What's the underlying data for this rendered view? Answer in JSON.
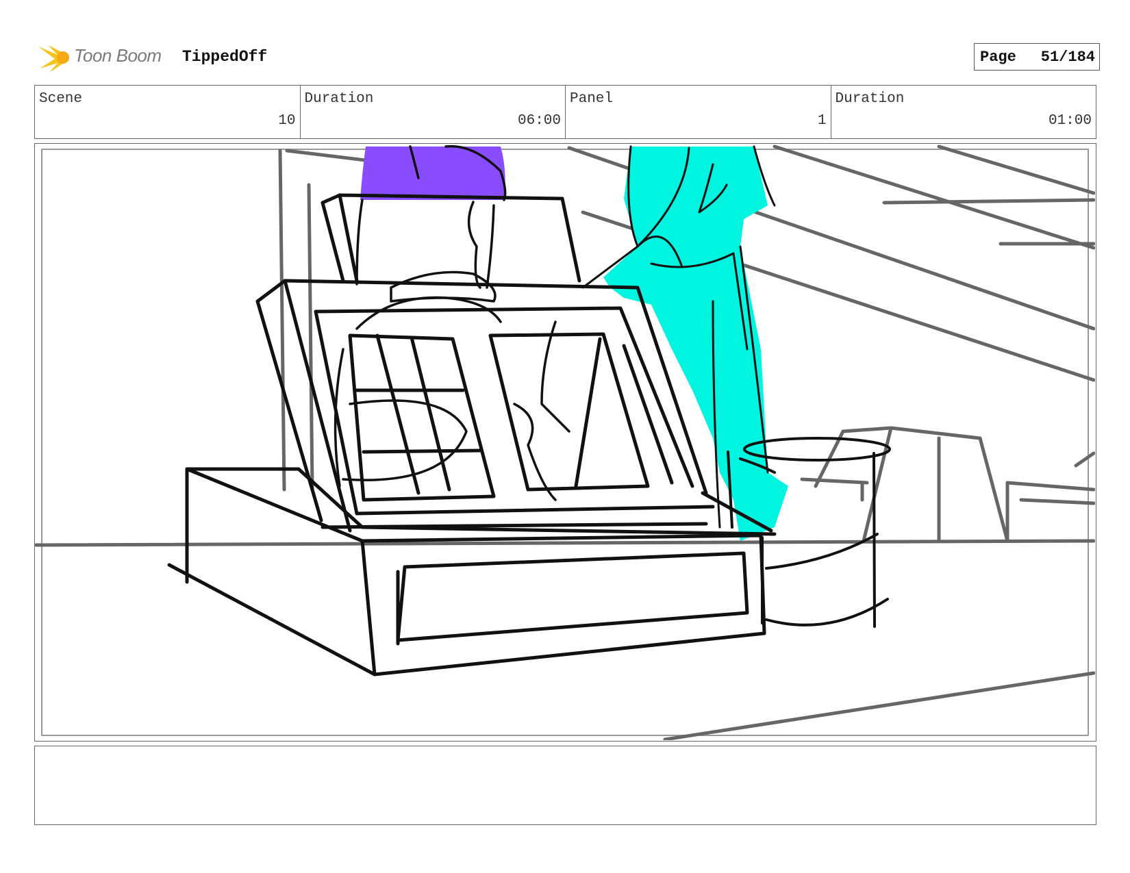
{
  "header": {
    "brand": "Toon Boom",
    "project": "TippedOff",
    "page_label": "Page",
    "page_value": "51/184"
  },
  "info": {
    "scene_label": "Scene",
    "scene_value": "10",
    "scene_duration_label": "Duration",
    "scene_duration_value": "06:00",
    "panel_label": "Panel",
    "panel_value": "1",
    "panel_duration_label": "Duration",
    "panel_duration_value": "01:00"
  },
  "colors": {
    "hair_purple": "#8a4cff",
    "figure_cyan": "#00f5e0",
    "logo_yellow": "#f7c21a"
  },
  "notes": {
    "text": ""
  }
}
